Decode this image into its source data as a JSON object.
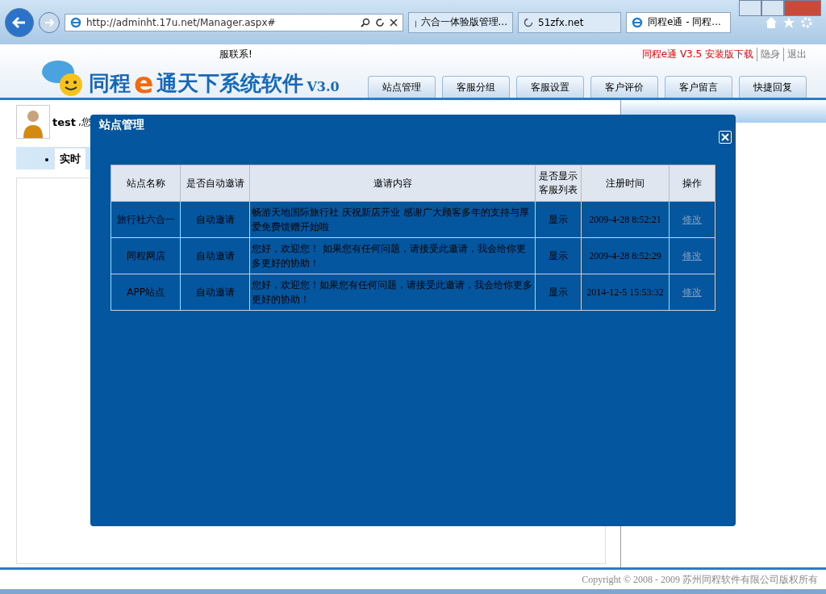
{
  "browser": {
    "address": "http://adminht.17u.net/Manager.aspx#",
    "tabs": [
      {
        "label": "六合一体验版管理...",
        "selected": false,
        "kind": "arrow"
      },
      {
        "label": "51zfx.net",
        "selected": false,
        "kind": "loading"
      },
      {
        "label": "同程e通 - 同程...",
        "selected": true,
        "kind": "ie"
      }
    ]
  },
  "header": {
    "notice": "服联系!",
    "logo": {
      "part1": "同程",
      "letter": "e",
      "part2": "通天下系统软件",
      "version": "V3.0"
    },
    "links": [
      {
        "label": "同程e通 V3.5 安装版下载",
        "kind": "download"
      },
      {
        "label": "隐身",
        "kind": "plain"
      },
      {
        "label": "退出",
        "kind": "plain"
      }
    ],
    "nav": [
      {
        "label": "站点管理",
        "selected": false
      },
      {
        "label": "客服分组",
        "selected": false
      },
      {
        "label": "客服设置",
        "selected": false
      },
      {
        "label": "客户评价",
        "selected": false
      },
      {
        "label": "客户留言",
        "selected": false
      },
      {
        "label": "快捷回复",
        "selected": false
      }
    ]
  },
  "user": {
    "name": "test",
    "greeting": ",您"
  },
  "left_tab": {
    "label": "实时"
  },
  "modal": {
    "title": "站点管理",
    "columns": [
      "站点名称",
      "是否自动邀请",
      "邀请内容",
      "是否显示客服列表",
      "注册时间",
      "操作"
    ],
    "rows": [
      {
        "site": "旅行社六合一",
        "auto": "自动邀请",
        "content": "畅游天地国际旅行社 庆祝新店开业 感谢广大顾客多年的支持与厚爱免费馈赠开始啦",
        "display": "显示",
        "time": "2009-4-28 8:52:21",
        "action": "修改"
      },
      {
        "site": "同程网店",
        "auto": "自动邀请",
        "content": "您好，欢迎您！ 如果您有任何问题，请接受此邀请，我会给你更多更好的协助！",
        "display": "显示",
        "time": "2009-4-28 8:52:29",
        "action": "修改"
      },
      {
        "site": "APP站点",
        "auto": "自动邀请",
        "content": "您好，欢迎您！如果您有任何问题，请接受此邀请，我会给你更多更好的协助！",
        "display": "显示",
        "time": "2014-12-5 15:53:32",
        "action": "修改"
      }
    ]
  },
  "footer": "Copyright © 2008 - 2009 苏州同程软件有限公司版权所有"
}
